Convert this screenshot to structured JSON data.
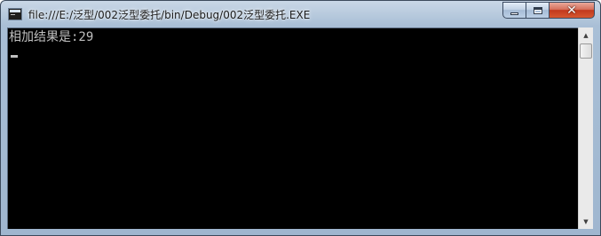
{
  "window": {
    "title": "file:///E:/泛型/002泛型委托/bin/Debug/002泛型委托.EXE",
    "controls": {
      "minimize_glyph": "▁",
      "maximize_glyph": "□",
      "close_glyph": "✕"
    }
  },
  "console": {
    "lines": [
      "相加结果是:29"
    ],
    "cursor": "▬"
  },
  "scrollbar": {
    "up_glyph": "▲",
    "down_glyph": "▼"
  },
  "colors": {
    "console_bg": "#000000",
    "console_text": "#c0c0c0",
    "close_button": "#c2391d"
  }
}
